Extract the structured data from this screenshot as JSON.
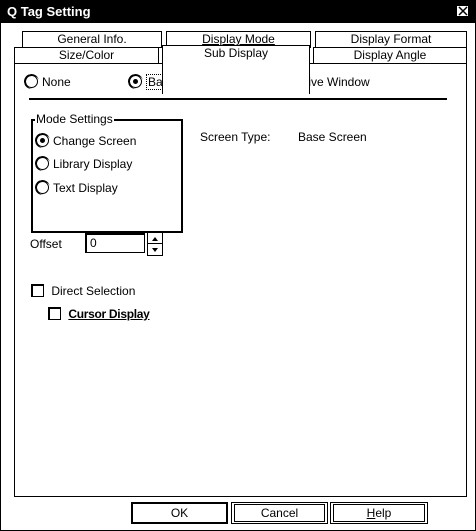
{
  "window": {
    "title": "Q Tag Setting"
  },
  "tabs": {
    "row1": [
      "General Info.",
      "Display Mode",
      "Display Format"
    ],
    "row2": [
      "Size/Color",
      "Sub Display",
      "Display Angle"
    ],
    "active": "Sub Display"
  },
  "sub_display": {
    "options": [
      "None",
      "Base Screen",
      "Active Window"
    ],
    "selected": "Base Screen"
  },
  "mode_settings": {
    "title": "Mode Settings",
    "options": [
      "Change Screen",
      "Library Display",
      "Text Display"
    ],
    "selected": "Change Screen"
  },
  "screen_type": {
    "label": "Screen Type:",
    "value": "Base Screen"
  },
  "offset": {
    "label": "Offset",
    "value": "0"
  },
  "direct_selection": {
    "label": "Direct Selection",
    "checked": false
  },
  "cursor_display": {
    "label": "Cursor Display",
    "checked": false,
    "enabled": false
  },
  "buttons": {
    "ok": "OK",
    "cancel": "Cancel",
    "help": "Help"
  }
}
